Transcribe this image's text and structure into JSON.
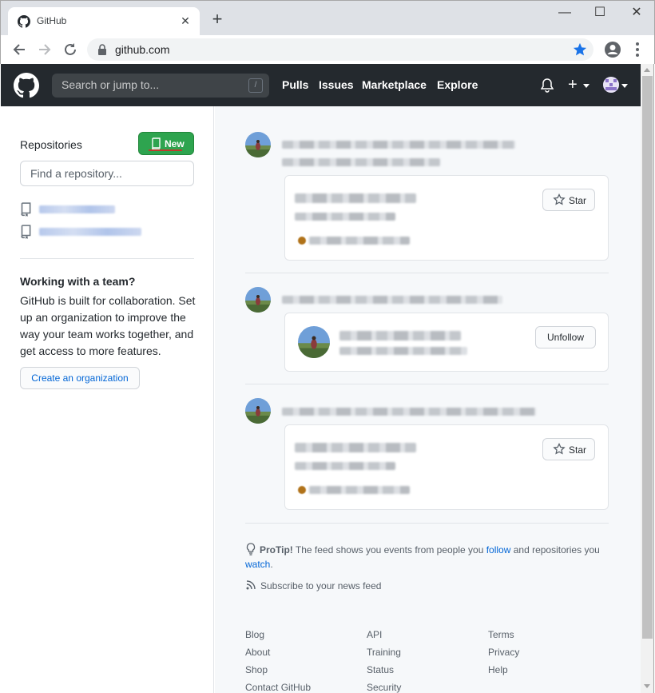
{
  "browser": {
    "tab_title": "GitHub",
    "tab_close": "✕",
    "new_tab": "+",
    "url": "github.com",
    "win_minimize": "—",
    "win_maximize": "☐",
    "win_close": "✕"
  },
  "header": {
    "search_placeholder": "Search or jump to...",
    "search_shortcut": "/",
    "nav": [
      "Pulls",
      "Issues",
      "Marketplace",
      "Explore"
    ],
    "plus": "+"
  },
  "sidebar": {
    "repos_heading": "Repositories",
    "new_button": "New",
    "find_placeholder": "Find a repository...",
    "team_heading": "Working with a team?",
    "team_text": "GitHub is built for collaboration. Set up an organization to improve the way your team works together, and get access to more features.",
    "create_org": "Create an organization"
  },
  "feed": {
    "star_label": "Star",
    "unfollow_label": "Unfollow"
  },
  "protip": {
    "label": "ProTip!",
    "text_1": " The feed shows you events from people you ",
    "follow_link": "follow",
    "text_2": " and repositories you ",
    "watch_link": "watch",
    "text_3": "."
  },
  "subscribe": "Subscribe to your news feed",
  "footer": {
    "col1": [
      "Blog",
      "About",
      "Shop",
      "Contact GitHub"
    ],
    "col2": [
      "API",
      "Training",
      "Status",
      "Security"
    ],
    "col3": [
      "Terms",
      "Privacy",
      "Help"
    ]
  },
  "colors": {
    "header_bg": "#24292e",
    "new_button_bg": "#2ea44f",
    "link": "#0366d6",
    "feed_bg": "#f6f8fa"
  }
}
